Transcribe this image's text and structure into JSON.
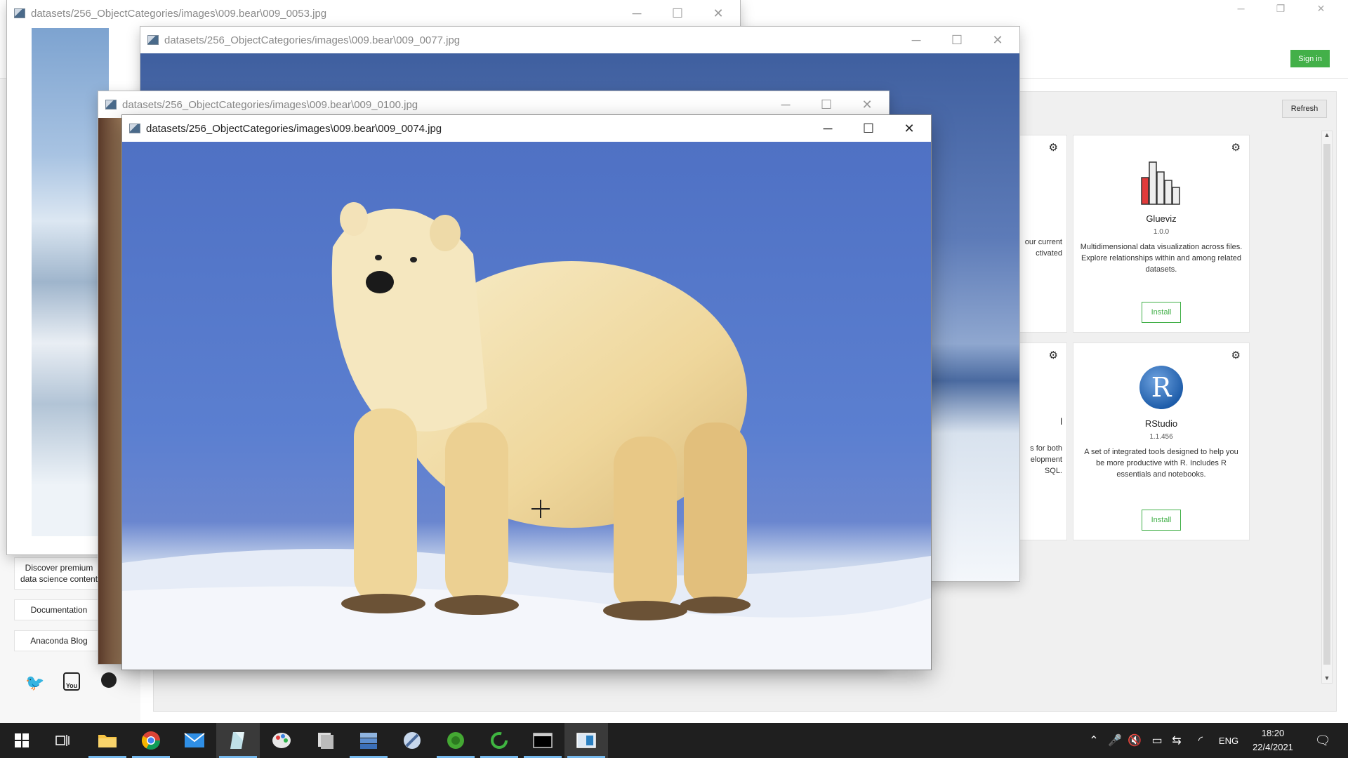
{
  "windows": {
    "w1": {
      "title": "datasets/256_ObjectCategories/images\\009.bear\\009_0053.jpg"
    },
    "w2": {
      "title": "datasets/256_ObjectCategories/images\\009.bear\\009_0077.jpg"
    },
    "w3": {
      "title": "datasets/256_ObjectCategories/images\\009.bear\\009_0100.jpg"
    },
    "w4": {
      "title": "datasets/256_ObjectCategories/images\\009.bear\\009_0074.jpg"
    },
    "controls": {
      "minimize": "─",
      "maximize": "☐",
      "close": "✕"
    }
  },
  "navigator": {
    "sign_in": "Sign in",
    "refresh": "Refresh",
    "cards": [
      {
        "name": "Glueviz",
        "version": "1.0.0",
        "description": "Multidimensional data visualization across files. Explore relationships within and among related datasets.",
        "action": "Install"
      },
      {
        "name": "RStudio",
        "version": "1.1.456",
        "description": "A set of integrated tools designed to help you be more productive with R. Includes R essentials and notebooks.",
        "action": "Install"
      }
    ],
    "partial_card_1": {
      "line1": "our current",
      "line2": "ctivated"
    },
    "partial_card_2": {
      "title": "l",
      "line1": "s for both",
      "line2": "elopment",
      "line3": "SQL."
    },
    "sidebar": {
      "discover": "Discover premium data science content",
      "documentation": "Documentation",
      "blog": "Anaconda Blog"
    },
    "social_icons": [
      "twitter-icon",
      "youtube-icon",
      "github-icon"
    ]
  },
  "taskbar": {
    "apps": [
      "start-icon",
      "task-view-icon",
      "file-explorer-icon",
      "chrome-icon",
      "mail-icon",
      "notes-icon",
      "paint-icon",
      "files-icon",
      "server-icon",
      "tool-icon",
      "anaconda-icon",
      "refresh-app-icon",
      "terminal-icon",
      "image-viewer-icon"
    ],
    "language": "ENG",
    "time": "18:20",
    "date": "22/4/2021"
  },
  "colors": {
    "accent_green": "#43b049",
    "taskbar": "#1f1f1f",
    "sky_blue": "#5b79c9"
  }
}
